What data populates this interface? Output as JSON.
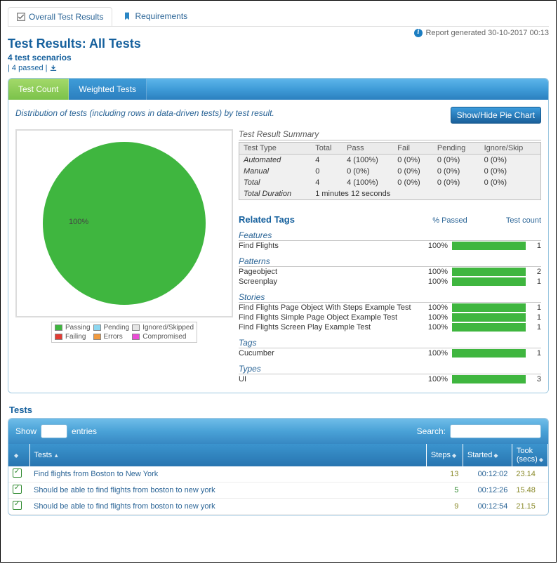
{
  "top_tabs": {
    "overall": "Overall Test Results",
    "requirements": "Requirements"
  },
  "report_generated": "Report generated 30-10-2017 00:13",
  "page_title": "Test Results: All Tests",
  "scenario_line": "4 test scenarios",
  "passed_line": "| 4 passed | ",
  "panel_tabs": {
    "test_count": "Test Count",
    "weighted": "Weighted Tests"
  },
  "distribution_text": "Distribution of tests (including rows in data-driven tests) by test result.",
  "show_hide_btn": "Show/Hide Pie Chart",
  "chart_data": {
    "type": "pie",
    "title": "",
    "categories": [
      "Passing"
    ],
    "values": [
      100
    ],
    "labels": [
      "100%"
    ],
    "series_colors": {
      "Passing": "#3fb63f"
    }
  },
  "legend": {
    "passing": "Passing",
    "pending": "Pending",
    "ignored": "Ignored/Skipped",
    "failing": "Failing",
    "errors": "Errors",
    "compromised": "Compromised",
    "colors": {
      "passing": "#3fb63f",
      "pending": "#8dd7f0",
      "ignored": "#e5e5e5",
      "failing": "#e33b33",
      "errors": "#f19a3e",
      "compromised": "#ec4bd6"
    }
  },
  "summary": {
    "heading": "Test Result Summary",
    "cols": {
      "test_type": "Test Type",
      "total": "Total",
      "pass": "Pass",
      "fail": "Fail",
      "pending": "Pending",
      "ignore": "Ignore/Skip"
    },
    "rows": [
      {
        "type": "Automated",
        "total": "4",
        "pass": "4 (100%)",
        "fail": "0 (0%)",
        "pending": "0 (0%)",
        "ignore": "0 (0%)"
      },
      {
        "type": "Manual",
        "total": "0",
        "pass": "0 (0%)",
        "fail": "0 (0%)",
        "pending": "0 (0%)",
        "ignore": "0 (0%)"
      },
      {
        "type": "Total",
        "total": "4",
        "pass": "4 (100%)",
        "fail": "0 (0%)",
        "pending": "0 (0%)",
        "ignore": "0 (0%)"
      }
    ],
    "duration_label": "Total Duration",
    "duration_value": "1 minutes 12 seconds"
  },
  "related": {
    "title": "Related Tags",
    "pct_passed_hdr": "% Passed",
    "test_count_hdr": "Test count",
    "groups": [
      {
        "title": "Features",
        "items": [
          {
            "name": "Find Flights",
            "pct": "100%",
            "bar": 100,
            "count": "1"
          }
        ]
      },
      {
        "title": "Patterns",
        "items": [
          {
            "name": "Pageobject",
            "pct": "100%",
            "bar": 100,
            "count": "2"
          },
          {
            "name": "Screenplay",
            "pct": "100%",
            "bar": 100,
            "count": "1"
          }
        ]
      },
      {
        "title": "Stories",
        "items": [
          {
            "name": "Find Flights Page Object With Steps Example Test",
            "pct": "100%",
            "bar": 100,
            "count": "1"
          },
          {
            "name": "Find Flights Simple Page Object Example Test",
            "pct": "100%",
            "bar": 100,
            "count": "1"
          },
          {
            "name": "Find Flights Screen Play Example Test",
            "pct": "100%",
            "bar": 100,
            "count": "1"
          }
        ]
      },
      {
        "title": "Tags",
        "items": [
          {
            "name": "Cucumber",
            "pct": "100%",
            "bar": 100,
            "count": "1"
          }
        ]
      },
      {
        "title": "Types",
        "items": [
          {
            "name": "UI",
            "pct": "100%",
            "bar": 100,
            "count": "3"
          }
        ]
      }
    ]
  },
  "tests": {
    "heading": "Tests",
    "show_label": "Show",
    "entries_label": "entries",
    "search_label": "Search:",
    "search_value": "",
    "cols": {
      "tests": "Tests",
      "steps": "Steps",
      "started": "Started",
      "took": "Took (secs)"
    },
    "rows": [
      {
        "name": "Find flights from Boston to New York",
        "steps": "13",
        "started": "00:12:02",
        "took": "23.14"
      },
      {
        "name": "Should be able to find flights from boston to new york",
        "steps": "5",
        "started": "00:12:26",
        "took": "15.48"
      },
      {
        "name": "Should be able to find flights from boston to new york",
        "steps": "9",
        "started": "00:12:54",
        "took": "21.15"
      }
    ]
  }
}
